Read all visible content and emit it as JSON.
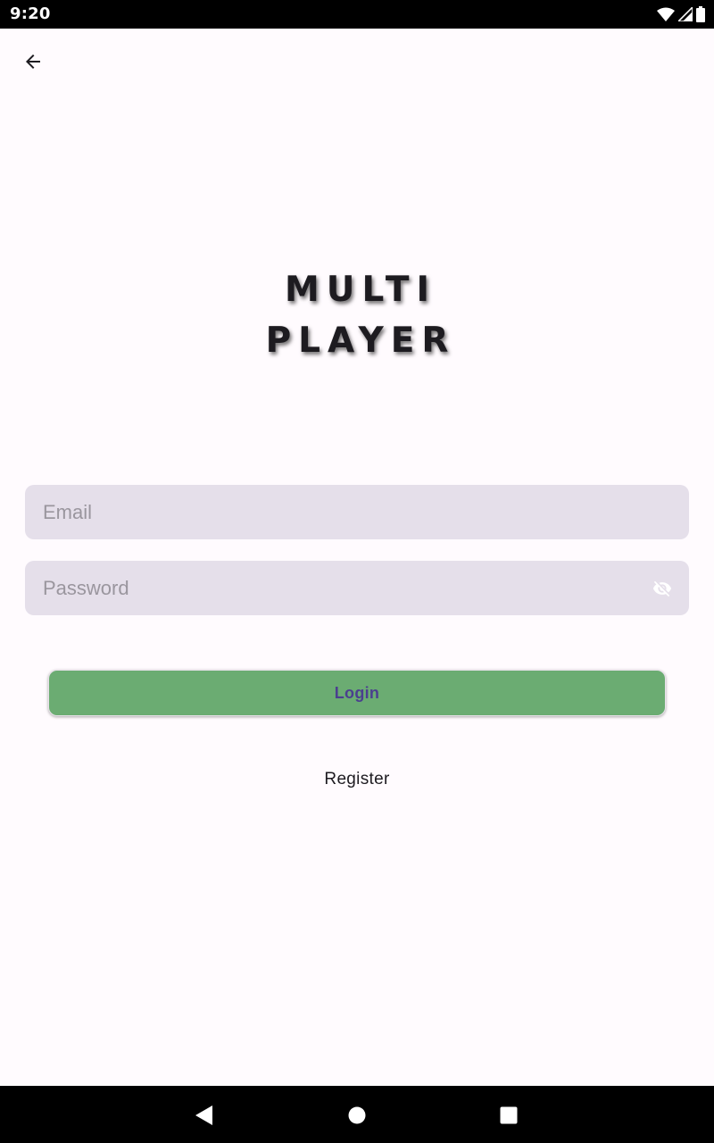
{
  "status_bar": {
    "time": "9:20",
    "icons": [
      "wifi-icon",
      "cellular-signal-icon",
      "battery-icon"
    ]
  },
  "app_bar": {
    "back_icon": "arrow-back-icon"
  },
  "title": {
    "line1": "MULTI",
    "line2": "PLAYER"
  },
  "form": {
    "email": {
      "placeholder": "Email",
      "value": ""
    },
    "password": {
      "placeholder": "Password",
      "value": "",
      "visibility_icon": "visibility-off-icon"
    },
    "login_label": "Login",
    "register_label": "Register"
  },
  "nav_bar": {
    "buttons": [
      "nav-back-icon",
      "nav-home-icon",
      "nav-recents-icon"
    ]
  },
  "colors": {
    "background": "#fffbfe",
    "field_background": "#e5dfea",
    "login_button": "#6bac72",
    "login_text": "#4b3f8f",
    "system_bars": "#000000"
  }
}
